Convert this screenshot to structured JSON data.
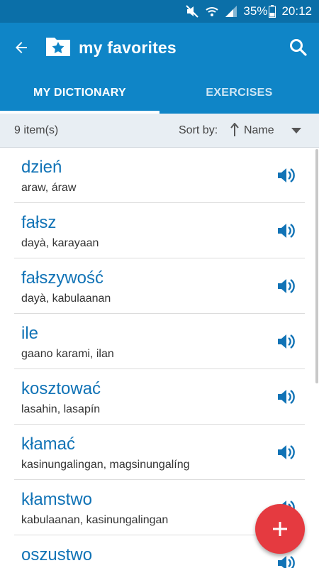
{
  "status": {
    "battery": "35%",
    "time": "20:12"
  },
  "appbar": {
    "title": "my favorites"
  },
  "tabs": [
    {
      "label": "MY DICTIONARY",
      "active": true
    },
    {
      "label": "EXERCISES",
      "active": false
    }
  ],
  "subbar": {
    "count": "9 item(s)",
    "sort_label": "Sort by:",
    "sort_value": "Name"
  },
  "items": [
    {
      "word": "dzień",
      "translation": "araw, áraw"
    },
    {
      "word": "fałsz",
      "translation": "dayà, karayaan"
    },
    {
      "word": "fałszywość",
      "translation": "dayà, kabulaanan"
    },
    {
      "word": "ile",
      "translation": "gaano karami, ilan"
    },
    {
      "word": "kosztować",
      "translation": "lasahin, lasapín"
    },
    {
      "word": "kłamać",
      "translation": "kasinungalingan, magsinungalíng"
    },
    {
      "word": "kłamstwo",
      "translation": "kabulaanan, kasinungalingan"
    },
    {
      "word": "oszustwo",
      "translation": ""
    }
  ],
  "colors": {
    "accent": "#0f85c7",
    "statusbar": "#0b6fa8",
    "word": "#1173b6",
    "fab": "#e53a40"
  },
  "icons": [
    "mute-icon",
    "wifi-icon",
    "signal-icon",
    "battery-icon",
    "back-arrow-icon",
    "favorites-folder-icon",
    "search-icon",
    "sort-arrow-icon",
    "dropdown-icon",
    "speaker-icon",
    "plus-icon"
  ]
}
